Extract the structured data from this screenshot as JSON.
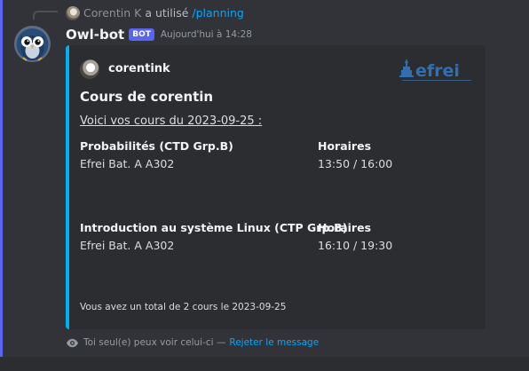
{
  "reply": {
    "username": "Corentin K",
    "action": "a utilisé",
    "command": "/planning"
  },
  "message": {
    "username": "Owl-bot",
    "badge": "BOT",
    "timestamp": "Aujourd'hui à 14:28"
  },
  "embed": {
    "accent_color": "#00b0f4",
    "author": "corentink",
    "thumbnail_text": "efrei",
    "title": "Cours de corentin",
    "description": "Voici vos cours du 2023-09-25 :",
    "courses": [
      {
        "name": "Probabilités (CTD Grp.B)",
        "location": "Efrei Bat. A A302",
        "schedule_label": "Horaires",
        "schedule": "13:50 / 16:00"
      },
      {
        "name": "Introduction au système Linux (CTP Grp.B)",
        "location": "Efrei Bat. A A302",
        "schedule_label": "Horaires",
        "schedule": "16:10 / 19:30"
      }
    ],
    "footer": "Vous avez un total de 2 cours le 2023-09-25"
  },
  "ephemeral": {
    "notice": "Toi seul(e) peux voir celui-ci —",
    "dismiss": "Rejeter le message"
  },
  "colors": {
    "background": "#323338",
    "embed_background": "#2b2d31",
    "link": "#00a8fc",
    "bot_badge": "#5865f2"
  }
}
